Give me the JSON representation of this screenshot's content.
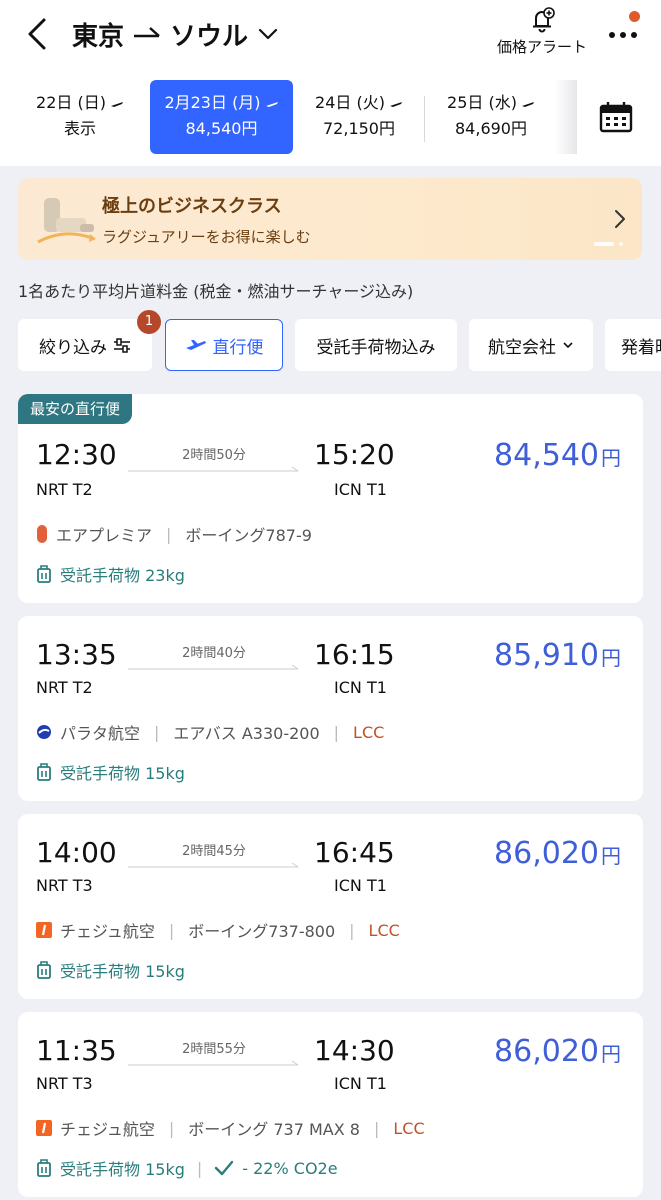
{
  "header": {
    "origin": "東京",
    "destination": "ソウル",
    "alert_label": "価格アラート"
  },
  "dates": [
    {
      "date": "22日 (日)",
      "sub": "表示",
      "selected": false
    },
    {
      "date": "2月23日 (月)",
      "sub": "84,540円",
      "selected": true
    },
    {
      "date": "24日 (火)",
      "sub": "72,150円",
      "selected": false
    },
    {
      "date": "25日 (水)",
      "sub": "84,690円",
      "selected": false
    }
  ],
  "banner": {
    "title": "極上のビジネスクラス",
    "subtitle": "ラグジュアリーをお得に楽しむ"
  },
  "fare_note": "1名あたり平均片道料金 (税金・燃油サーチャージ込み)",
  "filters": {
    "refine": "絞り込み",
    "refine_badge": "1",
    "direct": "直行便",
    "baggage": "受託手荷物込み",
    "airline": "航空会社",
    "departure": "発着時"
  },
  "flights": [
    {
      "tag": "最安の直行便",
      "dep_time": "12:30",
      "dep_airport": "NRT T2",
      "arr_time": "15:20",
      "arr_airport": "ICN T1",
      "duration": "2時間50分",
      "price": "84,540",
      "currency": "円",
      "airline": "エアプレミア",
      "aircraft": "ボーイング787-9",
      "lcc": "",
      "baggage": "受託手荷物 23kg",
      "co2": "",
      "logo": "air-premia-logo"
    },
    {
      "tag": "",
      "dep_time": "13:35",
      "dep_airport": "NRT T2",
      "arr_time": "16:15",
      "arr_airport": "ICN T1",
      "duration": "2時間40分",
      "price": "85,910",
      "currency": "円",
      "airline": "パラタ航空",
      "aircraft": "エアバス A330-200",
      "lcc": "LCC",
      "baggage": "受託手荷物 15kg",
      "co2": "",
      "logo": "parata-air-logo"
    },
    {
      "tag": "",
      "dep_time": "14:00",
      "dep_airport": "NRT T3",
      "arr_time": "16:45",
      "arr_airport": "ICN T1",
      "duration": "2時間45分",
      "price": "86,020",
      "currency": "円",
      "airline": "チェジュ航空",
      "aircraft": "ボーイング737-800",
      "lcc": "LCC",
      "baggage": "受託手荷物 15kg",
      "co2": "",
      "logo": "jeju-air-logo"
    },
    {
      "tag": "",
      "dep_time": "11:35",
      "dep_airport": "NRT T3",
      "arr_time": "14:30",
      "arr_airport": "ICN T1",
      "duration": "2時間55分",
      "price": "86,020",
      "currency": "円",
      "airline": "チェジュ航空",
      "aircraft": "ボーイング 737 MAX 8",
      "lcc": "LCC",
      "baggage": "受託手荷物 15kg",
      "co2": "- 22% CO2e",
      "logo": "jeju-air-logo"
    }
  ],
  "colors": {
    "accent": "#3264ff",
    "price": "#3f5fd8",
    "teal": "#2a7d7d",
    "tag": "#2e7682",
    "lcc": "#c0522a"
  }
}
